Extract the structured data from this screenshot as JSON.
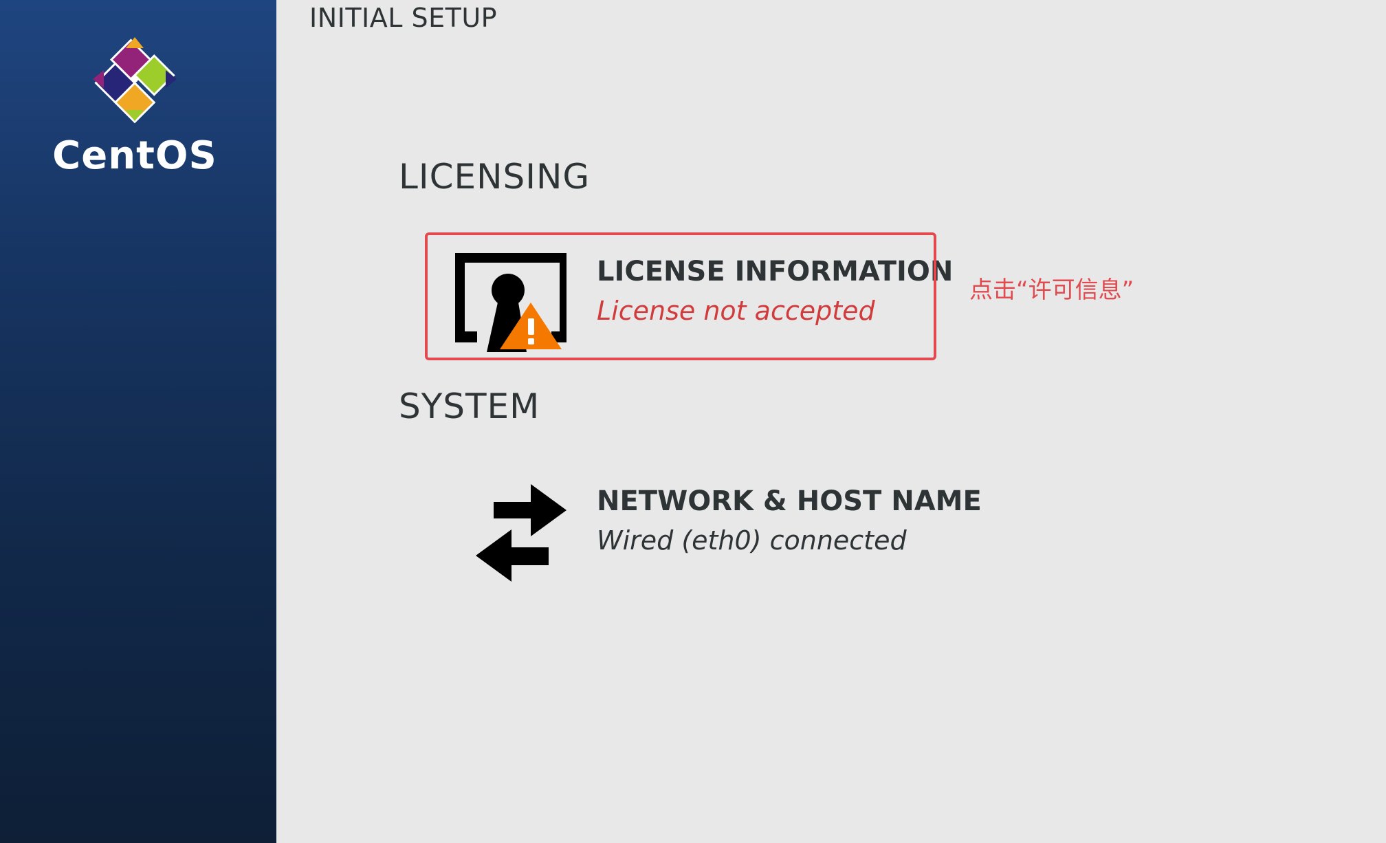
{
  "sidebar": {
    "logo_text": "CentOS"
  },
  "header": {
    "title": "INITIAL SETUP"
  },
  "sections": [
    {
      "heading": "LICENSING",
      "spokes": [
        {
          "title": "LICENSE INFORMATION",
          "status": "License not accepted",
          "icon": "license-warning-icon",
          "status_color": "#d13b3b"
        }
      ]
    },
    {
      "heading": "SYSTEM",
      "spokes": [
        {
          "title": "NETWORK & HOST NAME",
          "status": "Wired (eth0) connected",
          "icon": "network-arrows-icon",
          "status_color": "#2e3436"
        }
      ]
    }
  ],
  "annotation": {
    "text": "点击“许可信息”",
    "color": "#e14a4f"
  },
  "colors": {
    "sidebar_top": "#1f4580",
    "sidebar_bottom": "#0e1f36",
    "background": "#e8e8e8",
    "warning": "#f57900"
  }
}
